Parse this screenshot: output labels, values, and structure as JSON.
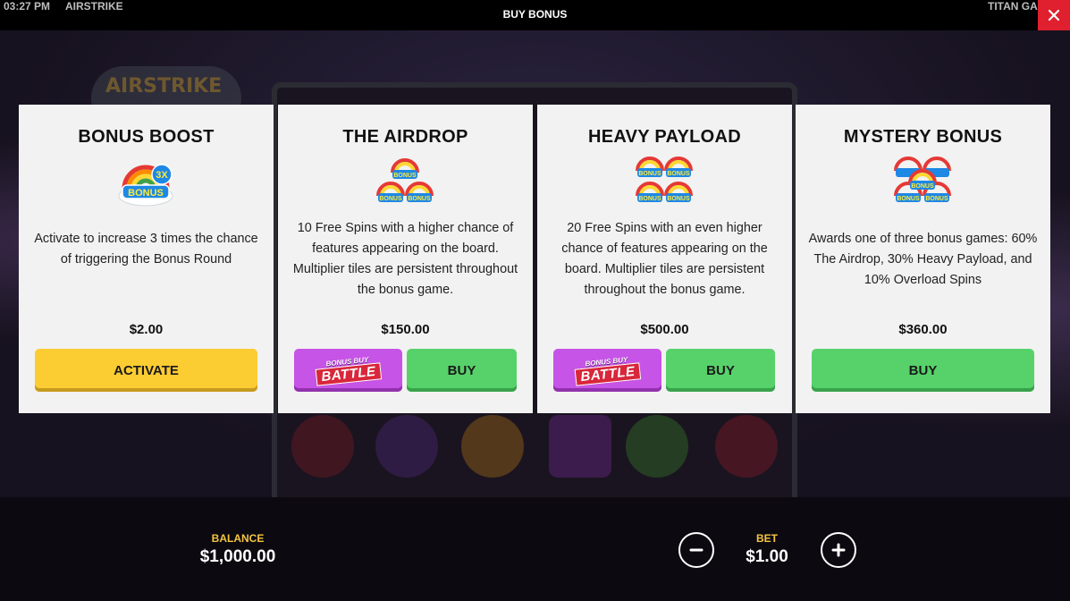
{
  "topbar": {
    "time": "03:27 PM",
    "game_name": "AIRSTRIKE",
    "title": "BUY BONUS",
    "provider": "TITAN GA",
    "close_icon": "close-icon"
  },
  "background": {
    "logo_text": "AIRSTRIKE"
  },
  "cards": [
    {
      "title": "BONUS BOOST",
      "icon": "rainbow-3x-bonus-icon",
      "icon_text_top": "3X",
      "icon_text_bottom": "BONUS",
      "description": "Activate to increase 3 times the chance of triggering the Bonus Round",
      "price": "$2.00",
      "button_label": "ACTIVATE"
    },
    {
      "title": "THE AIRDROP",
      "icon": "triple-bonus-icon",
      "icon_label": "BONUS",
      "description": "10 Free Spins with a higher chance of features appearing on the board. Multiplier tiles are persistent throughout the bonus game.",
      "price": "$150.00",
      "battle_top": "BONUS BUY",
      "battle_main": "BATTLE",
      "button_label": "BUY"
    },
    {
      "title": "HEAVY PAYLOAD",
      "icon": "quad-bonus-icon",
      "icon_label": "BONUS",
      "description": "20 Free Spins with an even higher chance of features appearing on the board. Multiplier tiles are persistent throughout the bonus game.",
      "price": "$500.00",
      "battle_top": "BONUS BUY",
      "battle_main": "BATTLE",
      "button_label": "BUY"
    },
    {
      "title": "MYSTERY BONUS",
      "icon": "stacked-bonus-icon",
      "icon_label": "BONUS",
      "description": "Awards one of three bonus games: 60% The Airdrop, 30% Heavy Payload, and 10% Overload Spins",
      "price": "$360.00",
      "button_label": "BUY"
    }
  ],
  "bottombar": {
    "balance_label": "BALANCE",
    "balance_value": "$1,000.00",
    "bet_label": "BET",
    "bet_value": "$1.00",
    "minus_icon": "minus-icon",
    "plus_icon": "plus-icon"
  },
  "colors": {
    "activate": "#fccc33",
    "buy": "#57d26a",
    "battle": "#c654e6",
    "close": "#e0202e",
    "label_gold": "#f5c542"
  }
}
